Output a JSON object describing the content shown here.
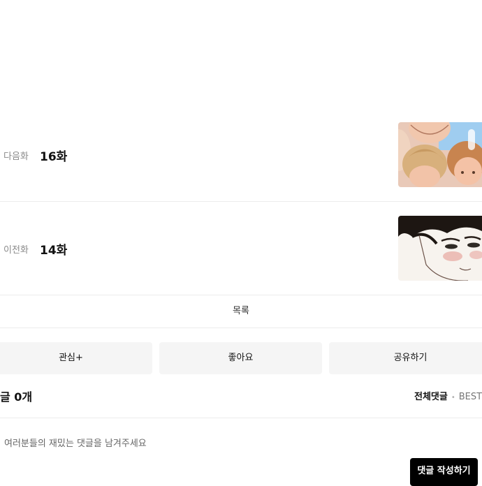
{
  "episodes": {
    "next": {
      "kind_label": "다음화",
      "title": "16화",
      "thumbnail_icon": "next-episode-thumbnail"
    },
    "prev": {
      "kind_label": "이전화",
      "title": "14화",
      "thumbnail_icon": "prev-episode-thumbnail"
    }
  },
  "list_link": {
    "label": "목록"
  },
  "actions": {
    "interest": "관심+",
    "like": "좋아요",
    "share": "공유하기"
  },
  "comments": {
    "title": "글 0개",
    "sort_all": "전체댓글",
    "sort_separator": "•",
    "sort_best": "BEST댓",
    "placeholder": "여러분들의 재밌는 댓글을 남겨주세요",
    "write_button": "댓글 작성하기"
  }
}
